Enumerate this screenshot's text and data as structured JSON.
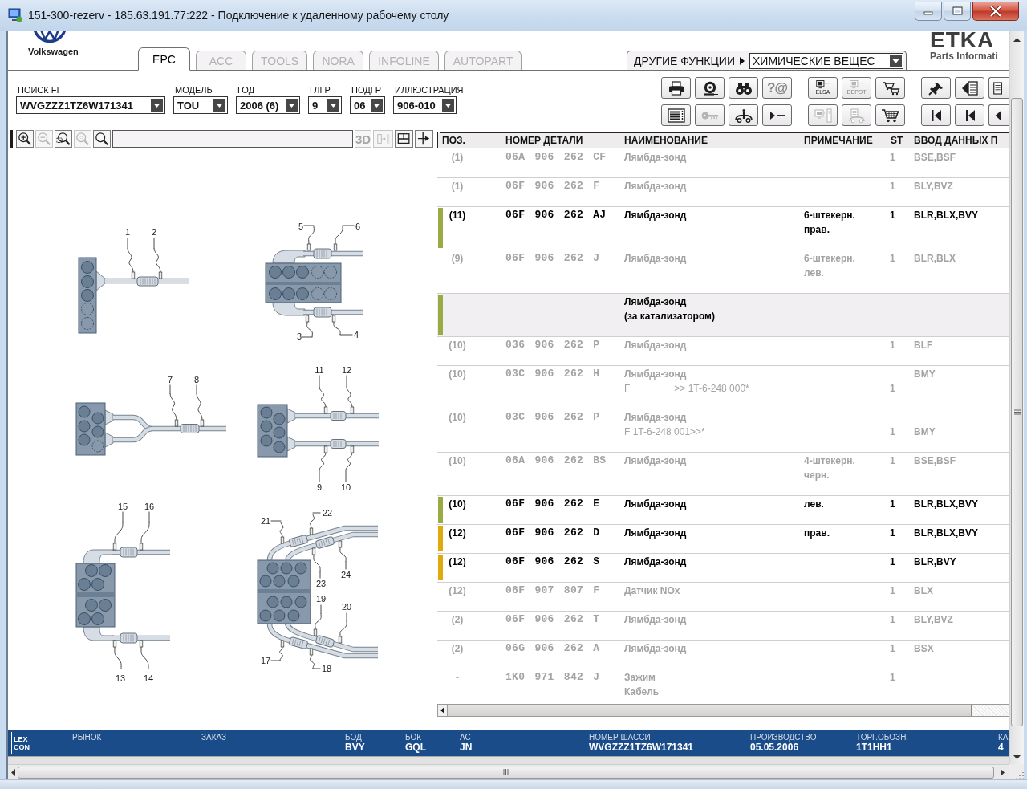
{
  "window": {
    "title": "151-300-rezerv - 185.63.191.77:222 - Подключение к удаленному рабочему столу"
  },
  "brand": {
    "name": "Volkswagen"
  },
  "tabs": [
    {
      "label": "EPC",
      "selected": true
    },
    {
      "label": "ACC",
      "selected": false
    },
    {
      "label": "TOOLS",
      "selected": false
    },
    {
      "label": "NORA",
      "selected": false
    },
    {
      "label": "INFOLINE",
      "selected": false
    },
    {
      "label": "AUTOPART",
      "selected": false
    }
  ],
  "other_functions": {
    "label": "ДРУГИЕ ФУНКЦИИ",
    "value": "ХИМИЧЕСКИЕ ВЕЩЕС"
  },
  "logo": {
    "name": "ETKA",
    "subtitle": "Parts Informati"
  },
  "filters": [
    {
      "label": "ПОИСК FI",
      "value": "WVGZZZ1TZ6W171341"
    },
    {
      "label": "МОДЕЛЬ",
      "value": "TOU"
    },
    {
      "label": "ГОД",
      "value": "2006 (6)"
    },
    {
      "label": "ГЛГР",
      "value": "9"
    },
    {
      "label": "ПОДГР",
      "value": "06"
    },
    {
      "label": "ИЛЛЮСТРАЦИЯ",
      "value": "906-010"
    }
  ],
  "toolbar": [
    [
      {
        "disabled": false
      },
      {
        "disabled": false
      },
      {
        "disabled": false
      },
      {
        "label": "?@",
        "disabled": true
      },
      {
        "label": "ELSA",
        "disabled": false
      },
      {
        "label": "DEPOT",
        "disabled": true
      },
      {
        "disabled": false
      },
      {
        "disabled": false
      },
      {
        "disabled": false
      },
      {
        "disabled": false
      }
    ],
    [
      {
        "disabled": false
      },
      {
        "disabled": true
      },
      {
        "disabled": false
      },
      {
        "disabled": false
      },
      {
        "disabled": true
      },
      {
        "disabled": true
      },
      {
        "disabled": false
      },
      {
        "disabled": false
      },
      {
        "disabled": false
      },
      {
        "disabled": false
      }
    ]
  ],
  "view_toolbar": {
    "zoom_buttons": [
      {
        "disabled": false
      },
      {
        "disabled": true
      },
      {
        "disabled": false
      },
      {
        "disabled": true
      },
      {
        "disabled": false
      }
    ],
    "tool_buttons": [
      {
        "label": "3D",
        "disabled": true
      },
      {
        "disabled": true
      },
      {
        "disabled": false
      },
      {
        "disabled": false
      }
    ]
  },
  "illustration": {
    "diagrams": [
      {
        "callouts": [
          "1",
          "2"
        ]
      },
      {
        "callouts": [
          "5",
          "6",
          "3",
          "4"
        ]
      },
      {
        "callouts": [
          "7",
          "8"
        ]
      },
      {
        "callouts": [
          "11",
          "12",
          "9",
          "10"
        ]
      },
      {
        "callouts": [
          "15",
          "16",
          "13",
          "14"
        ]
      },
      {
        "callouts": [
          "21",
          "22",
          "23",
          "24",
          "19",
          "20",
          "17",
          "18"
        ]
      }
    ]
  },
  "table": {
    "columns": [
      "ПОЗ.",
      "НОМЕР ДЕТАЛИ",
      "НАИМЕНОВАНИЕ",
      "ПРИМЕЧАНИЕ",
      "ST",
      "ВВОД ДАННЫХ П"
    ],
    "rows": [
      {
        "kind": "part",
        "applicable": false,
        "position": "(1)",
        "part_number": "06A 906 262 CF",
        "lines": [
          {
            "name": "Лямбда-зонд",
            "qty": "1",
            "codes": "BSE,BSF"
          }
        ]
      },
      {
        "kind": "part",
        "applicable": false,
        "position": "(1)",
        "part_number": "06F 906 262 F",
        "lines": [
          {
            "name": "Лямбда-зонд",
            "qty": "1",
            "codes": "BLY,BVZ"
          }
        ]
      },
      {
        "kind": "part",
        "applicable": true,
        "color": "#98ab45",
        "position": "(11)",
        "part_number": "06F 906 262 AJ",
        "lines": [
          {
            "name": "Лямбда-зонд",
            "note": "6-штекерн.",
            "qty": "1",
            "codes": "BLR,BLX,BVY"
          },
          {
            "note": "прав."
          }
        ]
      },
      {
        "kind": "part",
        "applicable": false,
        "position": "(9)",
        "part_number": "06F 906 262 J",
        "lines": [
          {
            "name": "Лямбда-зонд",
            "note": "6-штекерн.",
            "qty": "1",
            "codes": "BLR,BLX"
          },
          {
            "note": "лев."
          }
        ]
      },
      {
        "kind": "heading",
        "color": "#98ab45",
        "lines": [
          {
            "name": "Лямбда-зонд"
          },
          {
            "name": "(за катализатором)"
          }
        ]
      },
      {
        "kind": "part",
        "applicable": false,
        "position": "(10)",
        "part_number": "036 906 262 P",
        "lines": [
          {
            "name": "Лямбда-зонд",
            "qty": "1",
            "codes": "BLF"
          }
        ]
      },
      {
        "kind": "part",
        "applicable": false,
        "position": "(10)",
        "part_number": "03C 906 262 H",
        "lines": [
          {
            "name": "Лямбда-зонд",
            "codes": "BMY"
          },
          {
            "remark": "F",
            "remark_detail": ">> 1T-6-248 000*",
            "qty": "1"
          }
        ]
      },
      {
        "kind": "part",
        "applicable": false,
        "position": "(10)",
        "part_number": "03C 906 262 P",
        "lines": [
          {
            "name": "Лямбда-зонд"
          },
          {
            "remark": "F 1T-6-248 001>>*",
            "qty": "1",
            "codes": "BMY"
          }
        ]
      },
      {
        "kind": "part",
        "applicable": false,
        "position": "(10)",
        "part_number": "06A 906 262 BS",
        "lines": [
          {
            "name": "Лямбда-зонд",
            "note": "4-штекерн.",
            "qty": "1",
            "codes": "BSE,BSF"
          },
          {
            "note": "черн."
          }
        ]
      },
      {
        "kind": "part",
        "applicable": true,
        "color": "#98ab45",
        "position": "(10)",
        "part_number": "06F 906 262 E",
        "lines": [
          {
            "name": "Лямбда-зонд",
            "note": "лев.",
            "qty": "1",
            "codes": "BLR,BLX,BVY"
          }
        ]
      },
      {
        "kind": "part",
        "applicable": true,
        "color": "#e0a90c",
        "position": "(12)",
        "part_number": "06F 906 262 D",
        "lines": [
          {
            "name": "Лямбда-зонд",
            "note": "прав.",
            "qty": "1",
            "codes": "BLR,BLX,BVY"
          }
        ]
      },
      {
        "kind": "part",
        "applicable": true,
        "color": "#e0a90c",
        "position": "(12)",
        "part_number": "06F 906 262 S",
        "lines": [
          {
            "name": "Лямбда-зонд",
            "qty": "1",
            "codes": "BLR,BVY"
          }
        ]
      },
      {
        "kind": "part",
        "applicable": false,
        "position": "(12)",
        "part_number": "06F 907 807 F",
        "lines": [
          {
            "name": "Датчик NOx",
            "qty": "1",
            "codes": "BLX"
          }
        ]
      },
      {
        "kind": "part",
        "applicable": false,
        "position": "(2)",
        "part_number": "06F 906 262 T",
        "lines": [
          {
            "name": "Лямбда-зонд",
            "qty": "1",
            "codes": "BLY,BVZ"
          }
        ]
      },
      {
        "kind": "part",
        "applicable": false,
        "position": "(2)",
        "part_number": "06G 906 262 A",
        "lines": [
          {
            "name": "Лямбда-зонд",
            "qty": "1",
            "codes": "BSX"
          }
        ]
      },
      {
        "kind": "part",
        "applicable": false,
        "position": "-",
        "part_number": "1K0 971 842 J",
        "lines": [
          {
            "name": "Зажим",
            "qty": "1"
          },
          {
            "name": "Кабель"
          }
        ]
      }
    ]
  },
  "status_bar": {
    "logo": [
      "LEX",
      "CON"
    ],
    "fields": [
      {
        "label": "РЫНОК"
      },
      {
        "label": "ЗАКАЗ"
      },
      {
        "label": "БОД",
        "value": "BVY"
      },
      {
        "label": "БОК",
        "value": "GQL"
      },
      {
        "label": "АС",
        "value": "JN"
      },
      {
        "label": "НОМЕР ШАССИ",
        "value": "WVGZZZ1TZ6W171341"
      },
      {
        "label": "ПРОИЗВОДСТВО",
        "value": "05.05.2006"
      },
      {
        "label": "ТОРГ.ОБОЗН.",
        "value": "1T1HH1"
      },
      {
        "label": "КА",
        "value": "4"
      }
    ]
  }
}
